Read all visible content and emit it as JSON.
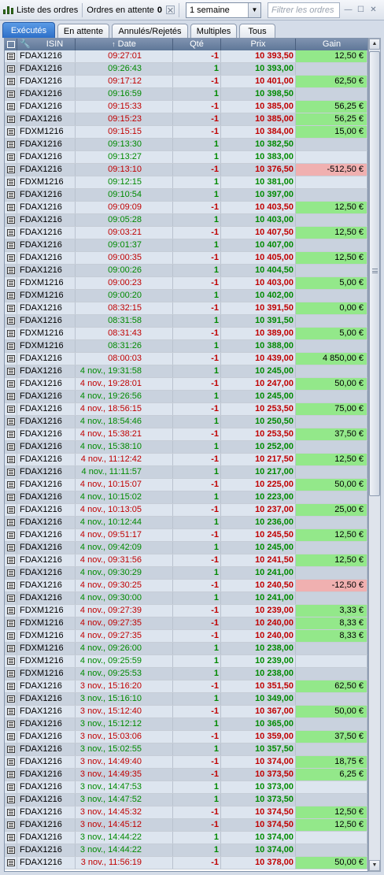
{
  "window": {
    "title": "Liste des ordres",
    "pending_label": "Ordres en attente",
    "pending_count": "0",
    "period_select": "1 semaine",
    "filter_placeholder": "Filtrer les ordres"
  },
  "tabs": [
    {
      "label": "Exécutés",
      "active": true
    },
    {
      "label": "En attente",
      "active": false
    },
    {
      "label": "Annulés/Rejetés",
      "active": false
    },
    {
      "label": "Multiples",
      "active": false
    },
    {
      "label": "Tous",
      "active": false
    }
  ],
  "columns": [
    "ISIN",
    "Date",
    "Qté",
    "Prix",
    "Gain"
  ],
  "icons": {
    "title": "bar-chart-icon",
    "settings": "wrench-icon",
    "row": "document-icon",
    "sort": "sort-up-arrow-icon"
  },
  "colors": {
    "sell": "#c00000",
    "buy": "#008a00",
    "gain_positive": "#93e88a",
    "gain_negative": "#f0b0b0",
    "active_tab": "#2d6fc8"
  },
  "rows": [
    {
      "isin": "FDAX1216",
      "date": "09:27:01",
      "qty": "-1",
      "price": "10 393,50",
      "gain": "12,50 €"
    },
    {
      "isin": "FDAX1216",
      "date": "09:26:43",
      "qty": "1",
      "price": "10 393,00",
      "gain": ""
    },
    {
      "isin": "FDAX1216",
      "date": "09:17:12",
      "qty": "-1",
      "price": "10 401,00",
      "gain": "62,50 €"
    },
    {
      "isin": "FDAX1216",
      "date": "09:16:59",
      "qty": "1",
      "price": "10 398,50",
      "gain": ""
    },
    {
      "isin": "FDAX1216",
      "date": "09:15:33",
      "qty": "-1",
      "price": "10 385,00",
      "gain": "56,25 €"
    },
    {
      "isin": "FDAX1216",
      "date": "09:15:23",
      "qty": "-1",
      "price": "10 385,00",
      "gain": "56,25 €"
    },
    {
      "isin": "FDXM1216",
      "date": "09:15:15",
      "qty": "-1",
      "price": "10 384,00",
      "gain": "15,00 €"
    },
    {
      "isin": "FDAX1216",
      "date": "09:13:30",
      "qty": "1",
      "price": "10 382,50",
      "gain": ""
    },
    {
      "isin": "FDAX1216",
      "date": "09:13:27",
      "qty": "1",
      "price": "10 383,00",
      "gain": ""
    },
    {
      "isin": "FDAX1216",
      "date": "09:13:10",
      "qty": "-1",
      "price": "10 376,50",
      "gain": "-512,50 €"
    },
    {
      "isin": "FDXM1216",
      "date": "09:12:15",
      "qty": "1",
      "price": "10 381,00",
      "gain": ""
    },
    {
      "isin": "FDAX1216",
      "date": "09:10:54",
      "qty": "1",
      "price": "10 397,00",
      "gain": ""
    },
    {
      "isin": "FDAX1216",
      "date": "09:09:09",
      "qty": "-1",
      "price": "10 403,50",
      "gain": "12,50 €"
    },
    {
      "isin": "FDAX1216",
      "date": "09:05:28",
      "qty": "1",
      "price": "10 403,00",
      "gain": ""
    },
    {
      "isin": "FDAX1216",
      "date": "09:03:21",
      "qty": "-1",
      "price": "10 407,50",
      "gain": "12,50 €"
    },
    {
      "isin": "FDAX1216",
      "date": "09:01:37",
      "qty": "1",
      "price": "10 407,00",
      "gain": ""
    },
    {
      "isin": "FDAX1216",
      "date": "09:00:35",
      "qty": "-1",
      "price": "10 405,00",
      "gain": "12,50 €"
    },
    {
      "isin": "FDAX1216",
      "date": "09:00:26",
      "qty": "1",
      "price": "10 404,50",
      "gain": ""
    },
    {
      "isin": "FDXM1216",
      "date": "09:00:23",
      "qty": "-1",
      "price": "10 403,00",
      "gain": "5,00 €"
    },
    {
      "isin": "FDXM1216",
      "date": "09:00:20",
      "qty": "1",
      "price": "10 402,00",
      "gain": ""
    },
    {
      "isin": "FDAX1216",
      "date": "08:32:15",
      "qty": "-1",
      "price": "10 391,50",
      "gain": "0,00 €"
    },
    {
      "isin": "FDAX1216",
      "date": "08:31:58",
      "qty": "1",
      "price": "10 391,50",
      "gain": ""
    },
    {
      "isin": "FDXM1216",
      "date": "08:31:43",
      "qty": "-1",
      "price": "10 389,00",
      "gain": "5,00 €"
    },
    {
      "isin": "FDXM1216",
      "date": "08:31:26",
      "qty": "1",
      "price": "10 388,00",
      "gain": ""
    },
    {
      "isin": "FDAX1216",
      "date": "08:00:03",
      "qty": "-1",
      "price": "10 439,00",
      "gain": "4 850,00 €"
    },
    {
      "isin": "FDAX1216",
      "date": "4 nov., 19:31:58",
      "qty": "1",
      "price": "10 245,00",
      "gain": ""
    },
    {
      "isin": "FDAX1216",
      "date": "4 nov., 19:28:01",
      "qty": "-1",
      "price": "10 247,00",
      "gain": "50,00 €"
    },
    {
      "isin": "FDAX1216",
      "date": "4 nov., 19:26:56",
      "qty": "1",
      "price": "10 245,00",
      "gain": ""
    },
    {
      "isin": "FDAX1216",
      "date": "4 nov., 18:56:15",
      "qty": "-1",
      "price": "10 253,50",
      "gain": "75,00 €"
    },
    {
      "isin": "FDAX1216",
      "date": "4 nov., 18:54:46",
      "qty": "1",
      "price": "10 250,50",
      "gain": ""
    },
    {
      "isin": "FDAX1216",
      "date": "4 nov., 15:38:21",
      "qty": "-1",
      "price": "10 253,50",
      "gain": "37,50 €"
    },
    {
      "isin": "FDAX1216",
      "date": "4 nov., 15:38:10",
      "qty": "1",
      "price": "10 252,00",
      "gain": ""
    },
    {
      "isin": "FDAX1216",
      "date": "4 nov., 11:12:42",
      "qty": "-1",
      "price": "10 217,50",
      "gain": "12,50 €"
    },
    {
      "isin": "FDAX1216",
      "date": "4 nov., 11:11:57",
      "qty": "1",
      "price": "10 217,00",
      "gain": ""
    },
    {
      "isin": "FDAX1216",
      "date": "4 nov., 10:15:07",
      "qty": "-1",
      "price": "10 225,00",
      "gain": "50,00 €"
    },
    {
      "isin": "FDAX1216",
      "date": "4 nov., 10:15:02",
      "qty": "1",
      "price": "10 223,00",
      "gain": ""
    },
    {
      "isin": "FDAX1216",
      "date": "4 nov., 10:13:05",
      "qty": "-1",
      "price": "10 237,00",
      "gain": "25,00 €"
    },
    {
      "isin": "FDAX1216",
      "date": "4 nov., 10:12:44",
      "qty": "1",
      "price": "10 236,00",
      "gain": ""
    },
    {
      "isin": "FDAX1216",
      "date": "4 nov., 09:51:17",
      "qty": "-1",
      "price": "10 245,50",
      "gain": "12,50 €"
    },
    {
      "isin": "FDAX1216",
      "date": "4 nov., 09:42:09",
      "qty": "1",
      "price": "10 245,00",
      "gain": ""
    },
    {
      "isin": "FDAX1216",
      "date": "4 nov., 09:31:56",
      "qty": "-1",
      "price": "10 241,50",
      "gain": "12,50 €"
    },
    {
      "isin": "FDAX1216",
      "date": "4 nov., 09:30:29",
      "qty": "1",
      "price": "10 241,00",
      "gain": ""
    },
    {
      "isin": "FDAX1216",
      "date": "4 nov., 09:30:25",
      "qty": "-1",
      "price": "10 240,50",
      "gain": "-12,50 €"
    },
    {
      "isin": "FDAX1216",
      "date": "4 nov., 09:30:00",
      "qty": "1",
      "price": "10 241,00",
      "gain": ""
    },
    {
      "isin": "FDXM1216",
      "date": "4 nov., 09:27:39",
      "qty": "-1",
      "price": "10 239,00",
      "gain": "3,33 €"
    },
    {
      "isin": "FDXM1216",
      "date": "4 nov., 09:27:35",
      "qty": "-1",
      "price": "10 240,00",
      "gain": "8,33 €"
    },
    {
      "isin": "FDXM1216",
      "date": "4 nov., 09:27:35",
      "qty": "-1",
      "price": "10 240,00",
      "gain": "8,33 €"
    },
    {
      "isin": "FDXM1216",
      "date": "4 nov., 09:26:00",
      "qty": "1",
      "price": "10 238,00",
      "gain": ""
    },
    {
      "isin": "FDXM1216",
      "date": "4 nov., 09:25:59",
      "qty": "1",
      "price": "10 239,00",
      "gain": ""
    },
    {
      "isin": "FDXM1216",
      "date": "4 nov., 09:25:53",
      "qty": "1",
      "price": "10 238,00",
      "gain": ""
    },
    {
      "isin": "FDAX1216",
      "date": "3 nov., 15:16:20",
      "qty": "-1",
      "price": "10 351,50",
      "gain": "62,50 €"
    },
    {
      "isin": "FDAX1216",
      "date": "3 nov., 15:16:10",
      "qty": "1",
      "price": "10 349,00",
      "gain": ""
    },
    {
      "isin": "FDAX1216",
      "date": "3 nov., 15:12:40",
      "qty": "-1",
      "price": "10 367,00",
      "gain": "50,00 €"
    },
    {
      "isin": "FDAX1216",
      "date": "3 nov., 15:12:12",
      "qty": "1",
      "price": "10 365,00",
      "gain": ""
    },
    {
      "isin": "FDAX1216",
      "date": "3 nov., 15:03:06",
      "qty": "-1",
      "price": "10 359,00",
      "gain": "37,50 €"
    },
    {
      "isin": "FDAX1216",
      "date": "3 nov., 15:02:55",
      "qty": "1",
      "price": "10 357,50",
      "gain": ""
    },
    {
      "isin": "FDAX1216",
      "date": "3 nov., 14:49:40",
      "qty": "-1",
      "price": "10 374,00",
      "gain": "18,75 €"
    },
    {
      "isin": "FDAX1216",
      "date": "3 nov., 14:49:35",
      "qty": "-1",
      "price": "10 373,50",
      "gain": "6,25 €"
    },
    {
      "isin": "FDAX1216",
      "date": "3 nov., 14:47:53",
      "qty": "1",
      "price": "10 373,00",
      "gain": ""
    },
    {
      "isin": "FDAX1216",
      "date": "3 nov., 14:47:52",
      "qty": "1",
      "price": "10 373,50",
      "gain": ""
    },
    {
      "isin": "FDAX1216",
      "date": "3 nov., 14:45:32",
      "qty": "-1",
      "price": "10 374,50",
      "gain": "12,50 €"
    },
    {
      "isin": "FDAX1216",
      "date": "3 nov., 14:45:12",
      "qty": "-1",
      "price": "10 374,50",
      "gain": "12,50 €"
    },
    {
      "isin": "FDAX1216",
      "date": "3 nov., 14:44:22",
      "qty": "1",
      "price": "10 374,00",
      "gain": ""
    },
    {
      "isin": "FDAX1216",
      "date": "3 nov., 14:44:22",
      "qty": "1",
      "price": "10 374,00",
      "gain": ""
    },
    {
      "isin": "FDAX1216",
      "date": "3 nov., 11:56:19",
      "qty": "-1",
      "price": "10 378,00",
      "gain": "50,00 €"
    }
  ]
}
